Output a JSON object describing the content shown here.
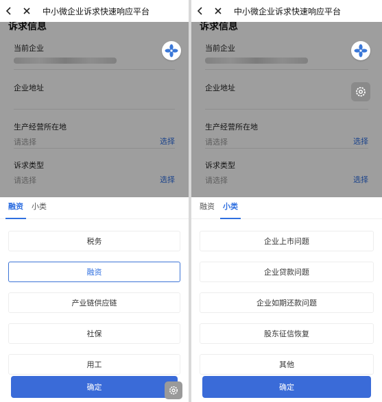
{
  "app": {
    "title": "中小微企业诉求快速响应平台"
  },
  "form": {
    "section_title": "诉求信息",
    "fields": [
      {
        "label": "当前企业",
        "value": ""
      },
      {
        "label": "企业地址",
        "value": ""
      },
      {
        "label": "生产经营所在地",
        "placeholder": "请选择",
        "action": "选择"
      },
      {
        "label": "诉求类型",
        "placeholder": "请选择",
        "action": "选择"
      }
    ]
  },
  "left_sheet": {
    "tabs": [
      {
        "label": "融资",
        "active": true
      },
      {
        "label": "小类",
        "active": false
      }
    ],
    "options": [
      {
        "label": "税务",
        "selected": false
      },
      {
        "label": "融资",
        "selected": true
      },
      {
        "label": "产业链供应链",
        "selected": false
      },
      {
        "label": "社保",
        "selected": false
      },
      {
        "label": "用工",
        "selected": false
      }
    ],
    "confirm_label": "确定"
  },
  "right_sheet": {
    "tabs": [
      {
        "label": "融资",
        "active": false
      },
      {
        "label": "小类",
        "active": true
      }
    ],
    "options": [
      {
        "label": "企业上市问题",
        "selected": false
      },
      {
        "label": "企业贷款问题",
        "selected": false
      },
      {
        "label": "企业如期还款问题",
        "selected": false
      },
      {
        "label": "股东征信恢复",
        "selected": false
      },
      {
        "label": "其他",
        "selected": false
      }
    ],
    "confirm_label": "确定"
  },
  "icons": {
    "back": "chevron-left-icon",
    "close": "close-icon",
    "logo": "pinwheel-logo-icon",
    "gear": "gear-icon"
  },
  "colors": {
    "accent": "#2f6fe0",
    "button": "#3a6bd8",
    "logo": "#3b78d8"
  }
}
